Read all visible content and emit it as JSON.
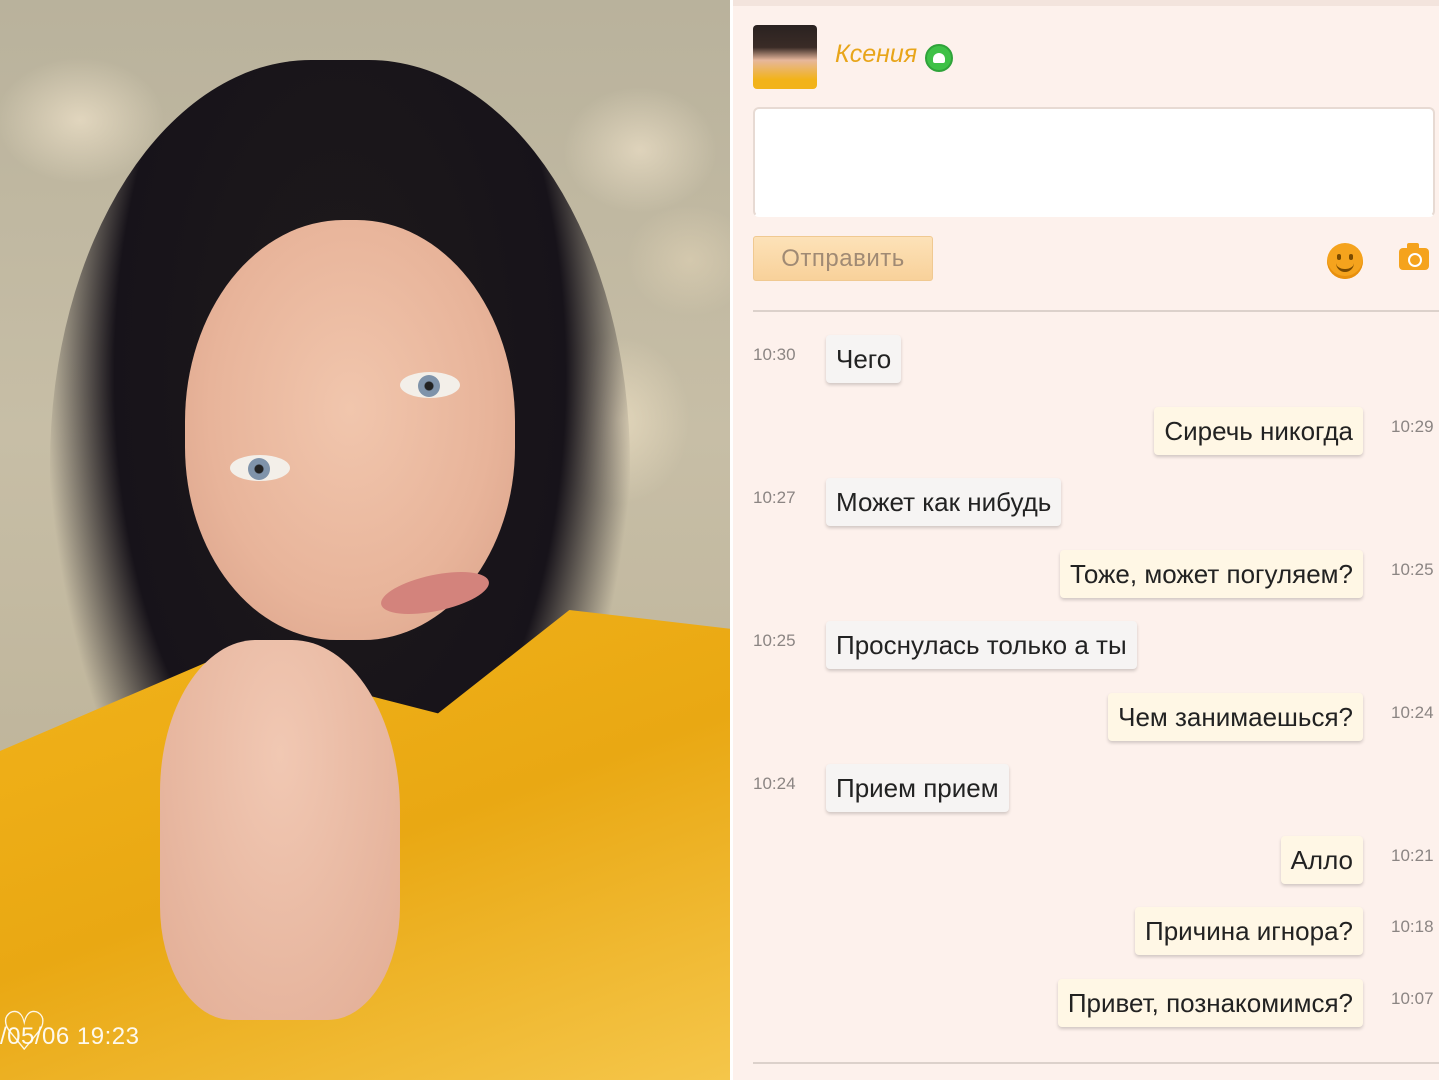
{
  "photo": {
    "timestamp": "/05/06 19:23"
  },
  "header": {
    "contact_name": "Ксения",
    "status_icon": "android-icon",
    "online_color": "#3ec147",
    "name_color": "#e8a51a"
  },
  "composer": {
    "input_value": "",
    "send_label": "Отправить",
    "emoji_icon": "smiley-icon",
    "photo_icon": "camera-icon"
  },
  "messages": [
    {
      "direction": "in",
      "text": "Чего",
      "time": "10:30"
    },
    {
      "direction": "out",
      "text": "Сиречь никогда",
      "time": "10:29"
    },
    {
      "direction": "in",
      "text": "Может как нибудь",
      "time": "10:27"
    },
    {
      "direction": "out",
      "text": "Тоже, может погуляем?",
      "time": "10:25"
    },
    {
      "direction": "in",
      "text": "Проснулась только а ты",
      "time": "10:25"
    },
    {
      "direction": "out",
      "text": "Чем занимаешься?",
      "time": "10:24"
    },
    {
      "direction": "in",
      "text": "Прием прием",
      "time": "10:24"
    },
    {
      "direction": "out",
      "text": "Алло",
      "time": "10:21"
    },
    {
      "direction": "out",
      "text": "Причина игнора?",
      "time": "10:18"
    },
    {
      "direction": "out",
      "text": "Привет, познакомимся?",
      "time": "10:07"
    }
  ]
}
